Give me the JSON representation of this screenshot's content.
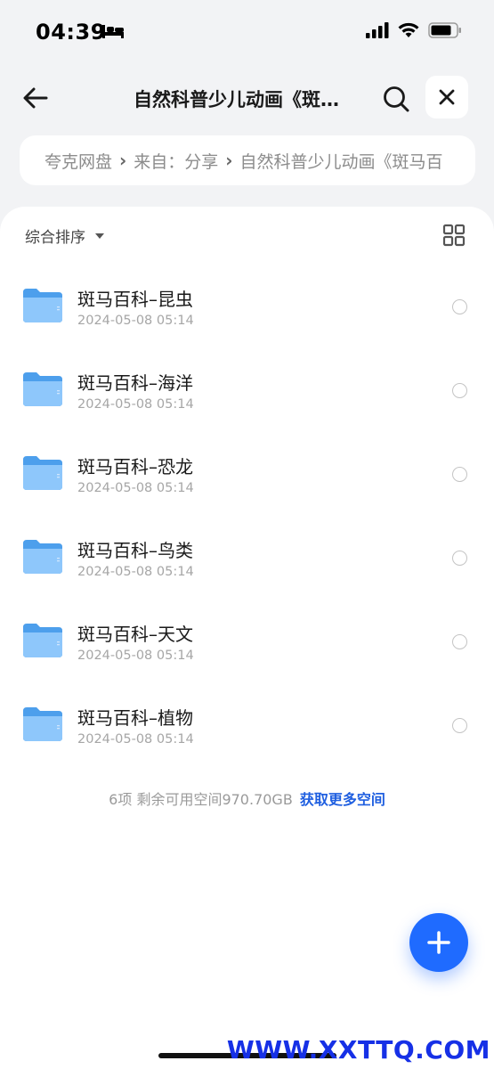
{
  "status_bar": {
    "time": "04:39"
  },
  "nav": {
    "title": "自然科普少儿动画《斑…"
  },
  "breadcrumb": {
    "items": [
      "夸克网盘",
      "来自：分享",
      "自然科普少儿动画《斑马百"
    ]
  },
  "sort": {
    "label": "综合排序"
  },
  "files": [
    {
      "name": "斑马百科–昆虫",
      "date": "2024-05-08 05:14"
    },
    {
      "name": "斑马百科–海洋",
      "date": "2024-05-08 05:14"
    },
    {
      "name": "斑马百科–恐龙",
      "date": "2024-05-08 05:14"
    },
    {
      "name": "斑马百科–鸟类",
      "date": "2024-05-08 05:14"
    },
    {
      "name": "斑马百科–天文",
      "date": "2024-05-08 05:14"
    },
    {
      "name": "斑马百科–植物",
      "date": "2024-05-08 05:14"
    }
  ],
  "footer": {
    "summary": "6项 剩余可用空间970.70GB",
    "more_space": "获取更多空间"
  },
  "watermark": "WWW.XXTTQ.COM",
  "colors": {
    "accent": "#1f6bff",
    "link": "#1f5fe0",
    "folder": "#5ba8f0"
  }
}
